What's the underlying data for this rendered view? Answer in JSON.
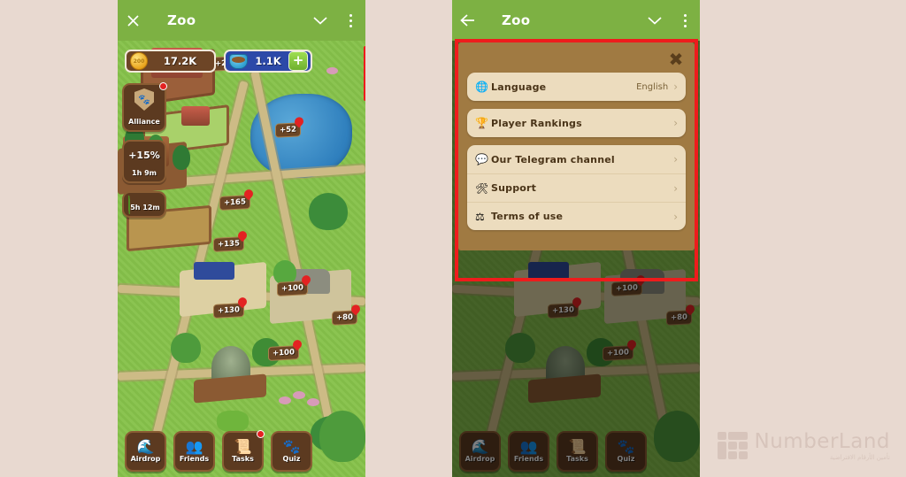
{
  "page": {
    "background_color": "#e8d9d0"
  },
  "left_panel": {
    "header": {
      "close_icon": "close-icon",
      "title": "Zoo",
      "chevron_icon": "chevron-down-icon",
      "kebab_icon": "more-vertical-icon"
    },
    "resources": {
      "coin": {
        "icon_label": "200",
        "value": "17.2K"
      },
      "food": {
        "value": "1.1K",
        "add_label": "+"
      }
    },
    "hamburger": {
      "icon": "hamburger-menu-icon",
      "highlighted": true
    },
    "side_badges": [
      {
        "icon": "alliance-shield-icon",
        "label": "Alliance",
        "badge_dot": true
      },
      {
        "value": "+15%",
        "label": "1h 9m"
      },
      {
        "icon": "leaf-icon",
        "label": "5h 12m"
      }
    ],
    "map_gains": [
      "+24",
      "+52",
      "+165",
      "+135",
      "+100",
      "+130",
      "+80",
      "+100"
    ],
    "bottom_nav": [
      {
        "icon": "parachute-icon",
        "label": "Airdrop",
        "badge": false
      },
      {
        "icon": "friends-icon",
        "label": "Friends",
        "badge": false
      },
      {
        "icon": "scroll-icon",
        "label": "Tasks",
        "badge": true
      },
      {
        "icon": "paw-icon",
        "label": "Quiz",
        "badge": false
      }
    ]
  },
  "right_panel": {
    "header": {
      "back_icon": "back-arrow-icon",
      "title": "Zoo",
      "chevron_icon": "chevron-down-icon",
      "kebab_icon": "more-vertical-icon"
    },
    "menu": {
      "close_label": "✖",
      "highlighted": true,
      "groups": [
        {
          "items": [
            {
              "icon": "globe-icon",
              "emoji": "🌐",
              "label": "Language",
              "value": "English",
              "chevron": "›"
            }
          ]
        },
        {
          "items": [
            {
              "icon": "trophy-icon",
              "emoji": "🏆",
              "label": "Player Rankings",
              "value": "",
              "chevron": "›"
            }
          ]
        },
        {
          "items": [
            {
              "icon": "chat-bubble-icon",
              "emoji": "💬",
              "label": "Our Telegram channel",
              "value": "",
              "chevron": "›"
            },
            {
              "icon": "tools-icon",
              "emoji": "🛠",
              "label": "Support",
              "value": "",
              "chevron": "›"
            },
            {
              "icon": "scales-icon",
              "emoji": "⚖",
              "label": "Terms of use",
              "value": "",
              "chevron": "›"
            }
          ]
        }
      ]
    },
    "bottom_nav": [
      {
        "icon": "parachute-icon",
        "label": "Airdrop"
      },
      {
        "icon": "friends-icon",
        "label": "Friends"
      },
      {
        "icon": "scroll-icon",
        "label": "Tasks"
      },
      {
        "icon": "paw-icon",
        "label": "Quiz"
      }
    ]
  },
  "watermark": {
    "name": "NumberLand",
    "subtitle": "تأمين الأرقام الافتراضية"
  },
  "colors": {
    "header_green": "#7db143",
    "grass_green": "#86c24a",
    "menu_brown": "#a07a42",
    "card_cream": "#ecdcbe",
    "highlight_red": "#ee1c1c"
  }
}
